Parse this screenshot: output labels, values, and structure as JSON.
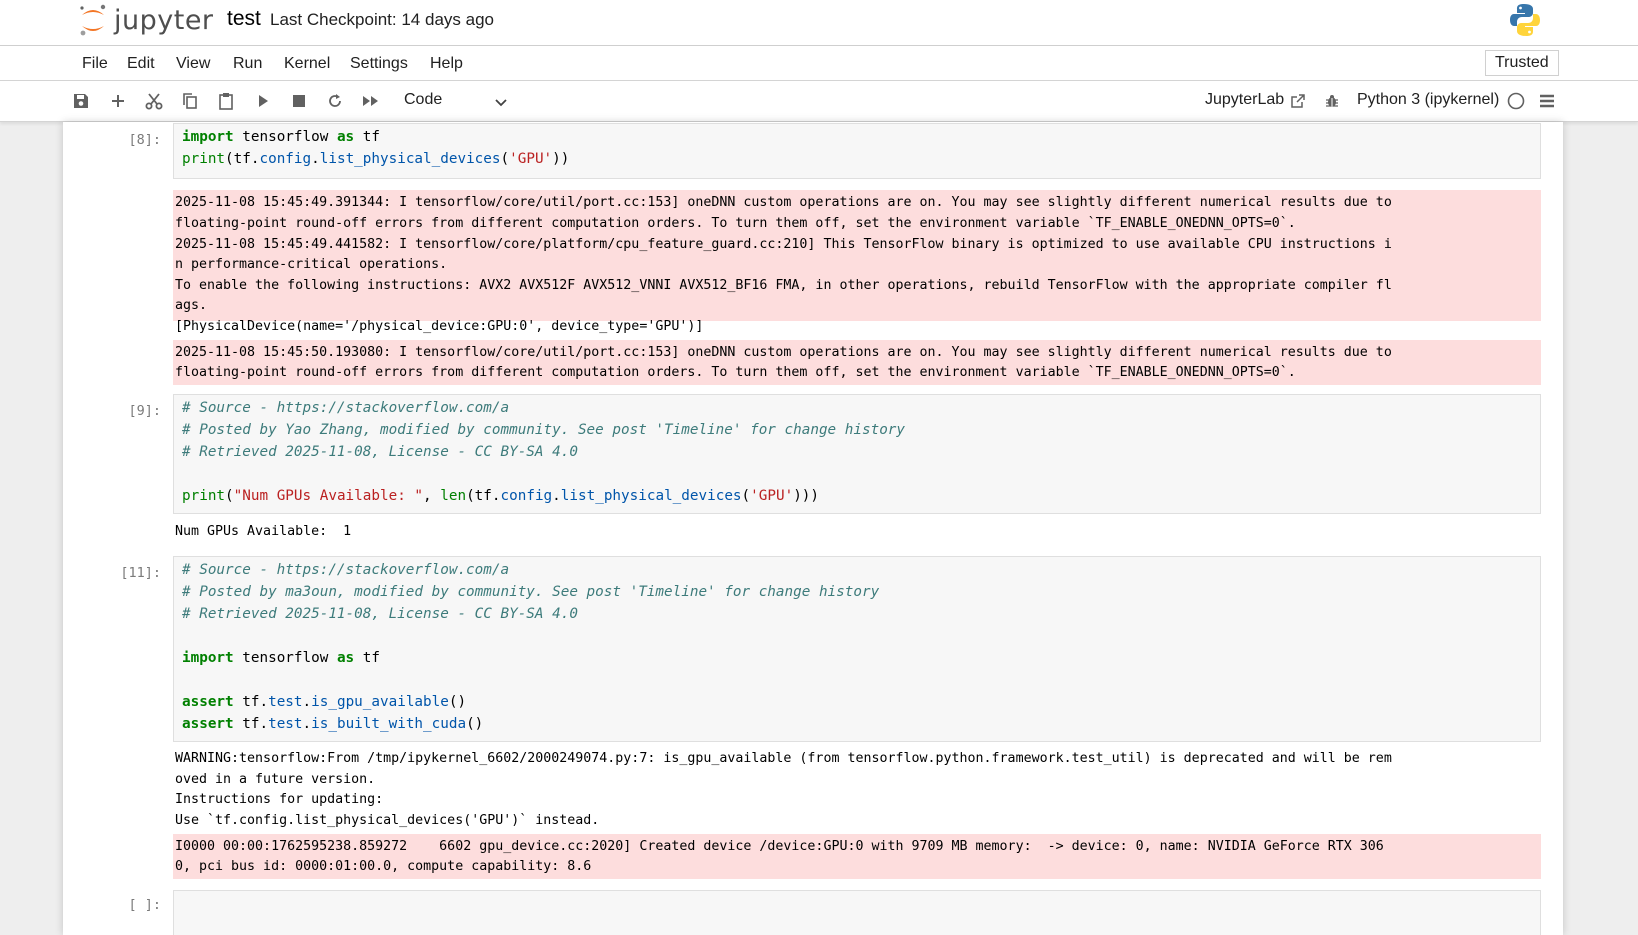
{
  "header": {
    "logo_text": "jupyter",
    "notebook_name": "test",
    "checkpoint": "Last Checkpoint: 14 days ago"
  },
  "menu": {
    "items": [
      "File",
      "Edit",
      "View",
      "Run",
      "Kernel",
      "Settings",
      "Help"
    ],
    "trusted": "Trusted"
  },
  "toolbar": {
    "cell_type": "Code",
    "jupyterlab_label": "JupyterLab",
    "kernel_label": "Python 3 (ipykernel)"
  },
  "cells": [
    {
      "prompt": "[8]:",
      "source": [
        "import tensorflow as tf",
        "print(tf.config.list_physical_devices('GPU'))"
      ],
      "stderr1": [
        "2025-11-08 15:45:49.391344: I tensorflow/core/util/port.cc:153] oneDNN custom operations are on. You may see slightly different numerical results due to",
        "floating-point round-off errors from different computation orders. To turn them off, set the environment variable `TF_ENABLE_ONEDNN_OPTS=0`.",
        "2025-11-08 15:45:49.441582: I tensorflow/core/platform/cpu_feature_guard.cc:210] This TensorFlow binary is optimized to use available CPU instructions i",
        "n performance-critical operations.",
        "To enable the following instructions: AVX2 AVX512F AVX512_VNNI AVX512_BF16 FMA, in other operations, rebuild TensorFlow with the appropriate compiler fl",
        "ags."
      ],
      "stdout": [
        "[PhysicalDevice(name='/physical_device:GPU:0', device_type='GPU')]"
      ],
      "stderr2": [
        "2025-11-08 15:45:50.193080: I tensorflow/core/util/port.cc:153] oneDNN custom operations are on. You may see slightly different numerical results due to",
        "floating-point round-off errors from different computation orders. To turn them off, set the environment variable `TF_ENABLE_ONEDNN_OPTS=0`."
      ]
    },
    {
      "prompt": "[9]:",
      "source": [
        "# Source - https://stackoverflow.com/a",
        "# Posted by Yao Zhang, modified by community. See post 'Timeline' for change history",
        "# Retrieved 2025-11-08, License - CC BY-SA 4.0",
        "",
        "print(\"Num GPUs Available: \", len(tf.config.list_physical_devices('GPU')))"
      ],
      "stdout": [
        "Num GPUs Available:  1"
      ]
    },
    {
      "prompt": "[11]:",
      "source": [
        "# Source - https://stackoverflow.com/a",
        "# Posted by ma3oun, modified by community. See post 'Timeline' for change history",
        "# Retrieved 2025-11-08, License - CC BY-SA 4.0",
        "",
        "import tensorflow as tf",
        "",
        "assert tf.test.is_gpu_available()",
        "assert tf.test.is_built_with_cuda()"
      ],
      "stdout": [
        "WARNING:tensorflow:From /tmp/ipykernel_6602/2000249074.py:7: is_gpu_available (from tensorflow.python.framework.test_util) is deprecated and will be rem",
        "oved in a future version.",
        "Instructions for updating:",
        "Use `tf.config.list_physical_devices('GPU')` instead."
      ],
      "stderr": [
        "I0000 00:00:1762595238.859272    6602 gpu_device.cc:2020] Created device /device:GPU:0 with 9709 MB memory:  -> device: 0, name: NVIDIA GeForce RTX 306",
        "0, pci bus id: 0000:01:00.0, compute capability: 8.6"
      ]
    },
    {
      "prompt": "[ ]:"
    }
  ]
}
